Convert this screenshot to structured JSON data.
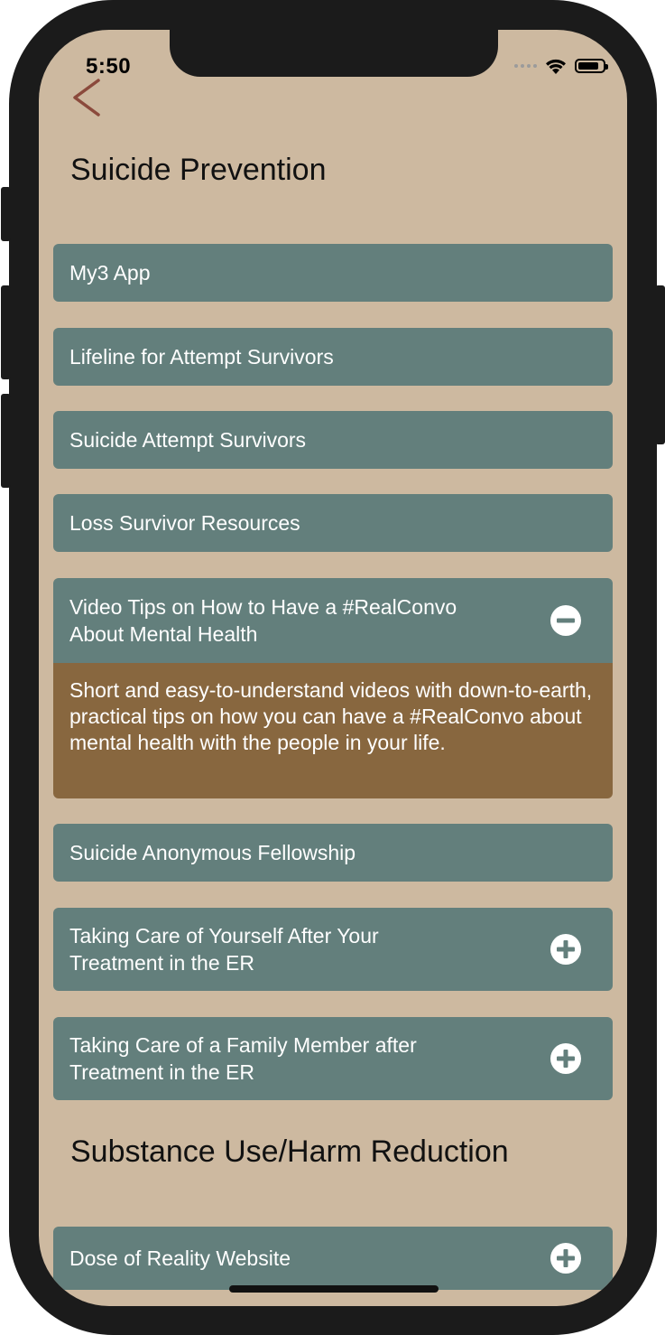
{
  "status_bar": {
    "time": "5:50"
  },
  "colors": {
    "background": "#cdb9a0",
    "item": "#637f7c",
    "detail": "#88673f",
    "back_arrow": "#8b4a3c"
  },
  "sections": [
    {
      "title": "Suicide Prevention",
      "items": [
        {
          "label": "My3 App"
        },
        {
          "label": "Lifeline for Attempt Survivors"
        },
        {
          "label": "Suicide Attempt Survivors"
        },
        {
          "label": "Loss Survivor Resources"
        },
        {
          "label": "Video Tips on How to Have a #RealConvo About Mental Health",
          "toggle_icon": "minus-circle-icon",
          "expanded": true,
          "description": "Short and easy-to-understand videos with down-to-earth, practical tips on how you can have a #RealConvo about mental health with the people in your life."
        },
        {
          "label": "Suicide Anonymous Fellowship"
        },
        {
          "label": "Taking Care of Yourself After Your Treatment in the ER",
          "toggle_icon": "plus-circle-icon"
        },
        {
          "label": "Taking Care of a Family Member after Treatment in the ER",
          "toggle_icon": "plus-circle-icon"
        }
      ]
    },
    {
      "title": "Substance Use/Harm Reduction",
      "items": [
        {
          "label": "Dose of Reality Website",
          "toggle_icon": "plus-circle-icon"
        }
      ]
    }
  ]
}
